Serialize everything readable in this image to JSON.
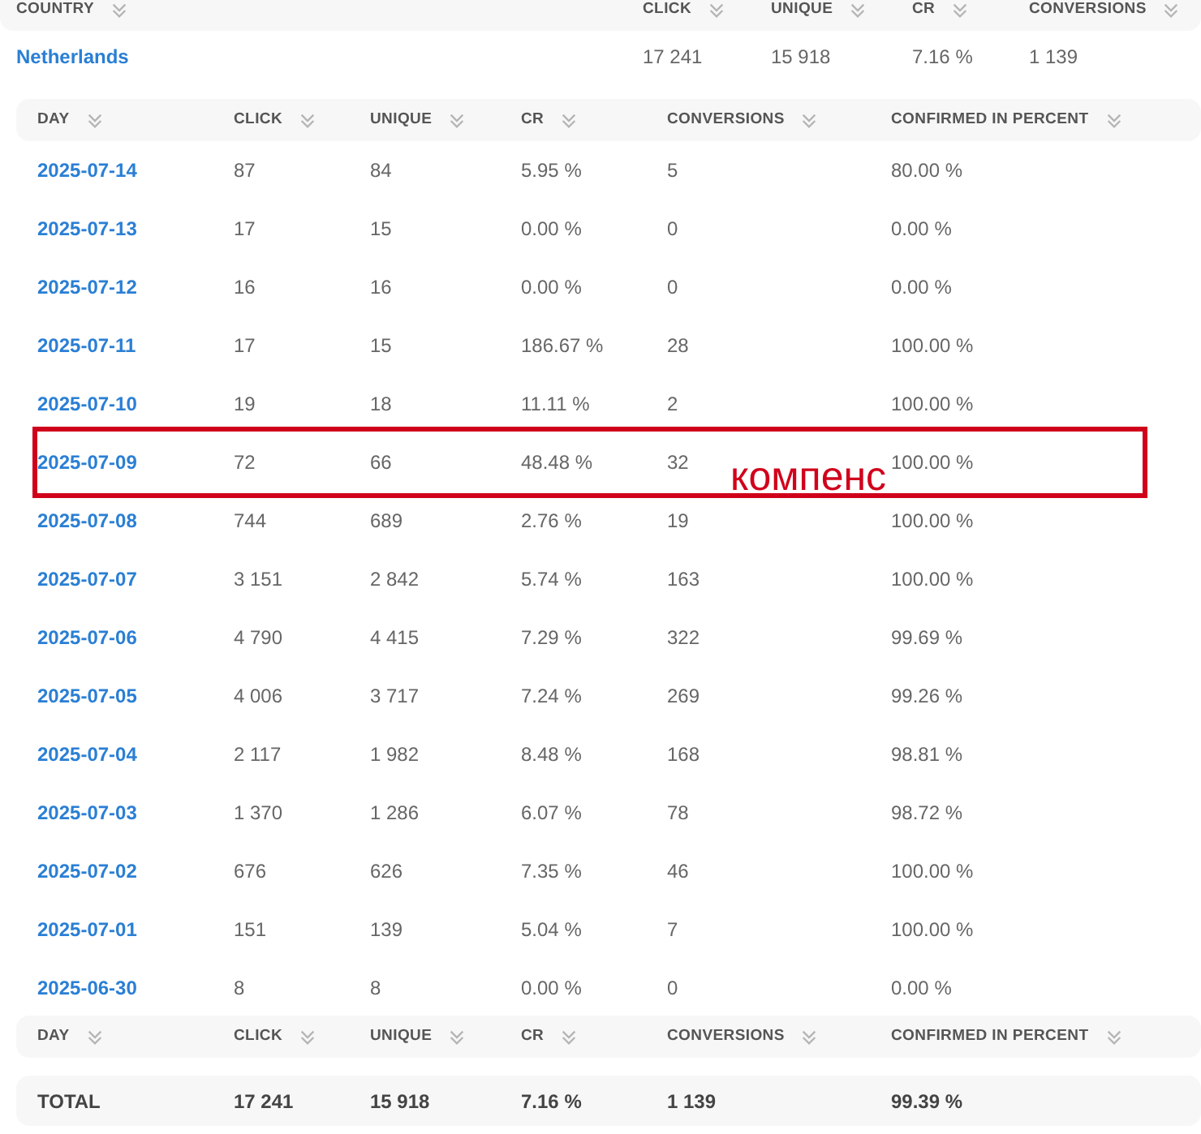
{
  "country_table": {
    "columns": [
      "COUNTRY",
      "CLICK",
      "UNIQUE",
      "CR",
      "CONVERSIONS"
    ],
    "row": {
      "country": "Netherlands",
      "click": "17 241",
      "unique": "15 918",
      "cr": "7.16 %",
      "conversions": "1 139"
    }
  },
  "day_table": {
    "columns": [
      "DAY",
      "CLICK",
      "UNIQUE",
      "CR",
      "CONVERSIONS",
      "CONFIRMED IN PERCENT"
    ],
    "rows": [
      {
        "day": "2025-07-14",
        "click": "87",
        "unique": "84",
        "cr": "5.95 %",
        "conversions": "5",
        "confirmed": "80.00 %",
        "highlighted": false
      },
      {
        "day": "2025-07-13",
        "click": "17",
        "unique": "15",
        "cr": "0.00 %",
        "conversions": "0",
        "confirmed": "0.00 %",
        "highlighted": false
      },
      {
        "day": "2025-07-12",
        "click": "16",
        "unique": "16",
        "cr": "0.00 %",
        "conversions": "0",
        "confirmed": "0.00 %",
        "highlighted": false
      },
      {
        "day": "2025-07-11",
        "click": "17",
        "unique": "15",
        "cr": "186.67 %",
        "conversions": "28",
        "confirmed": "100.00 %",
        "highlighted": false
      },
      {
        "day": "2025-07-10",
        "click": "19",
        "unique": "18",
        "cr": "11.11 %",
        "conversions": "2",
        "confirmed": "100.00 %",
        "highlighted": false
      },
      {
        "day": "2025-07-09",
        "click": "72",
        "unique": "66",
        "cr": "48.48 %",
        "conversions": "32",
        "confirmed": "100.00 %",
        "highlighted": true,
        "annotation": "компенс"
      },
      {
        "day": "2025-07-08",
        "click": "744",
        "unique": "689",
        "cr": "2.76 %",
        "conversions": "19",
        "confirmed": "100.00 %",
        "highlighted": false
      },
      {
        "day": "2025-07-07",
        "click": "3 151",
        "unique": "2 842",
        "cr": "5.74 %",
        "conversions": "163",
        "confirmed": "100.00 %",
        "highlighted": false
      },
      {
        "day": "2025-07-06",
        "click": "4 790",
        "unique": "4 415",
        "cr": "7.29 %",
        "conversions": "322",
        "confirmed": "99.69 %",
        "highlighted": false
      },
      {
        "day": "2025-07-05",
        "click": "4 006",
        "unique": "3 717",
        "cr": "7.24 %",
        "conversions": "269",
        "confirmed": "99.26 %",
        "highlighted": false
      },
      {
        "day": "2025-07-04",
        "click": "2 117",
        "unique": "1 982",
        "cr": "8.48 %",
        "conversions": "168",
        "confirmed": "98.81 %",
        "highlighted": false
      },
      {
        "day": "2025-07-03",
        "click": "1 370",
        "unique": "1 286",
        "cr": "6.07 %",
        "conversions": "78",
        "confirmed": "98.72 %",
        "highlighted": false
      },
      {
        "day": "2025-07-02",
        "click": "676",
        "unique": "626",
        "cr": "7.35 %",
        "conversions": "46",
        "confirmed": "100.00 %",
        "highlighted": false
      },
      {
        "day": "2025-07-01",
        "click": "151",
        "unique": "139",
        "cr": "5.04 %",
        "conversions": "7",
        "confirmed": "100.00 %",
        "highlighted": false
      },
      {
        "day": "2025-06-30",
        "click": "8",
        "unique": "8",
        "cr": "0.00 %",
        "conversions": "0",
        "confirmed": "0.00 %",
        "highlighted": false
      }
    ],
    "footer_columns": [
      "DAY",
      "CLICK",
      "UNIQUE",
      "CR",
      "CONVERSIONS",
      "CONFIRMED IN PERCENT"
    ],
    "total": {
      "label": "TOTAL",
      "click": "17 241",
      "unique": "15 918",
      "cr": "7.16 %",
      "conversions": "1 139",
      "confirmed": "99.39 %"
    }
  }
}
